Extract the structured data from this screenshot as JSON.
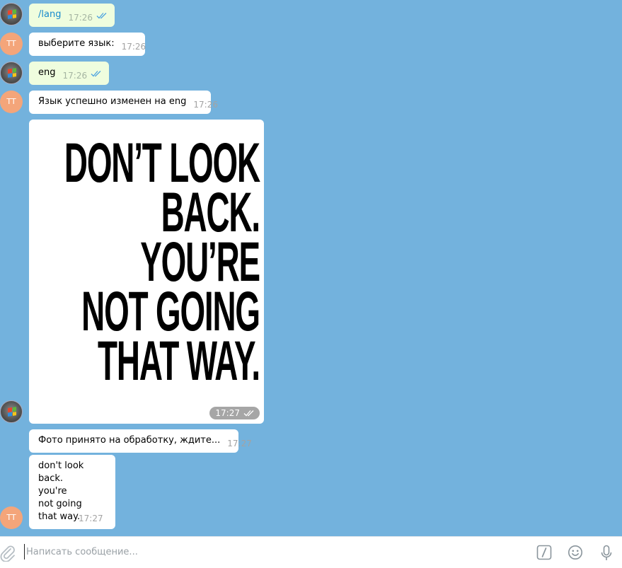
{
  "messages": [
    {
      "text": "/lang",
      "time": "17:26"
    },
    {
      "text": "выберите язык:",
      "time": "17:26"
    },
    {
      "text": "eng",
      "time": "17:26"
    },
    {
      "text": "Язык успешно изменен на eng",
      "time": "17:26"
    },
    {
      "time": "17:27",
      "poster_lines": [
        "DON’T LOOK",
        "BACK.",
        "YOU’RE",
        "NOT GOING",
        "THAT WAY."
      ]
    },
    {
      "text": "Фото принято на обработку, ждите...",
      "time": "17:27"
    },
    {
      "lines": [
        "don't look",
        "back.",
        "you're",
        "not going",
        "that way."
      ],
      "time": "17:27"
    }
  ],
  "bot_avatar_initials": "TT",
  "composer": {
    "placeholder": "Написать сообщение..."
  },
  "colors": {
    "chat_background": "#73b2dd",
    "outgoing_bubble": "#effdde",
    "incoming_bubble": "#ffffff",
    "command_link": "#168acd",
    "read_check": "#4da3e0",
    "bot_avatar": "#f4a57a"
  },
  "icons": [
    "attach-icon",
    "bot-command-icon",
    "emoji-icon",
    "microphone-icon",
    "read-receipt-icon",
    "windows-flag-icon"
  ]
}
